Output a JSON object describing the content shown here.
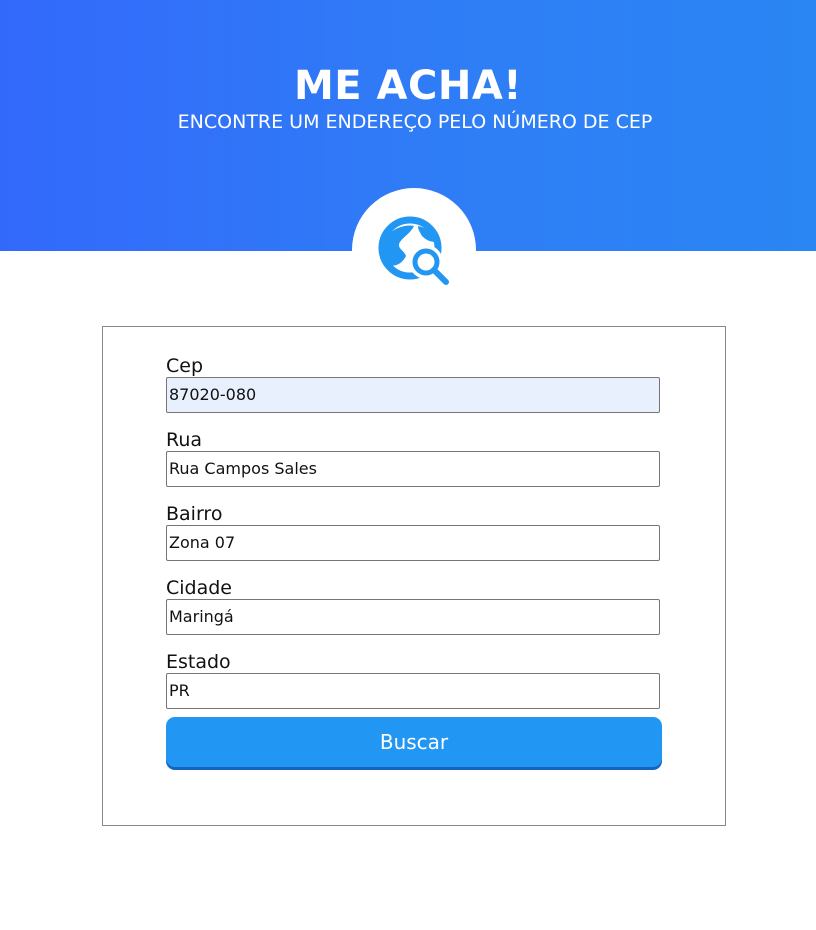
{
  "header": {
    "title": "ME ACHA!",
    "subtitle": "ENCONTRE UM ENDEREÇO PELO NÚMERO DE CEP",
    "logo_icon": "globe-search-icon",
    "colors": {
      "gradient_start": "#3369fb",
      "gradient_end": "#2a86f3",
      "icon": "#2196f3"
    }
  },
  "form": {
    "fields": [
      {
        "label": "Cep",
        "value": "87020-080",
        "autofilled": true
      },
      {
        "label": "Rua",
        "value": "Rua Campos Sales"
      },
      {
        "label": "Bairro",
        "value": "Zona 07"
      },
      {
        "label": "Cidade",
        "value": "Maringá"
      },
      {
        "label": "Estado",
        "value": "PR"
      }
    ],
    "submit_label": "Buscar",
    "submit_color": "#2196f3"
  }
}
